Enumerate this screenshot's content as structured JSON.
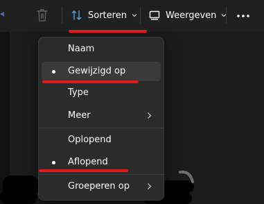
{
  "toolbar": {
    "sort": {
      "label": "Sorteren"
    },
    "view": {
      "label": "Weergeven"
    }
  },
  "sort_menu": {
    "items": [
      {
        "label": "Naam",
        "selected": false
      },
      {
        "label": "Gewijzigd op",
        "selected": true
      },
      {
        "label": "Type",
        "selected": false
      },
      {
        "label": "Meer",
        "selected": false,
        "submenu": true
      },
      {
        "label": "Oplopend",
        "selected": false
      },
      {
        "label": "Aflopend",
        "selected": true
      },
      {
        "label": "Groeperen op",
        "selected": false,
        "submenu": true
      }
    ]
  },
  "colors": {
    "highlight": "#e0191b",
    "menu_bg": "#2b2b2b",
    "toolbar_bg": "#1f1f1f"
  },
  "icons": [
    "trash-icon",
    "sort-icon",
    "view-icon",
    "chevron-down-icon",
    "more-icon",
    "chevron-right-icon"
  ]
}
